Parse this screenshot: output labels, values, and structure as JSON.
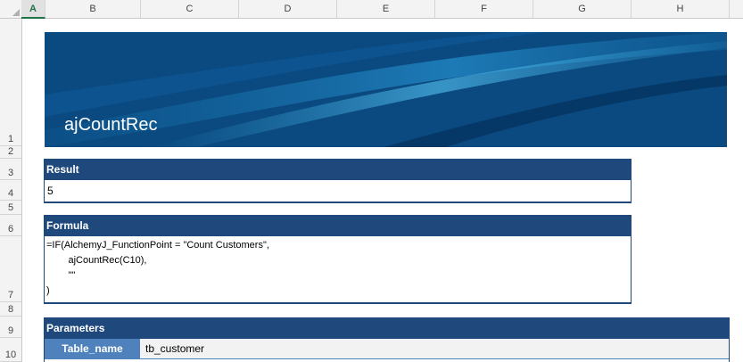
{
  "columns": {
    "corner": "",
    "A": "A",
    "B": "B",
    "C": "C",
    "D": "D",
    "E": "E",
    "F": "F",
    "G": "G",
    "H": "H"
  },
  "rows": [
    "1",
    "2",
    "3",
    "4",
    "5",
    "6",
    "7",
    "8",
    "9",
    "10"
  ],
  "banner": {
    "title": "ajCountRec"
  },
  "result": {
    "header": "Result",
    "value": "5"
  },
  "formula": {
    "header": "Formula",
    "lines": [
      "=IF(AlchemyJ_FunctionPoint = \"Count Customers\",",
      "        ajCountRec(C10),",
      "        \"\"",
      ")"
    ]
  },
  "parameters": {
    "header": "Parameters",
    "rows": [
      {
        "label": "Table_name",
        "value": "tb_customer"
      }
    ]
  },
  "colors": {
    "section_header": "#1f497d",
    "param_label": "#4f81bd",
    "selected_col": "#217346"
  }
}
